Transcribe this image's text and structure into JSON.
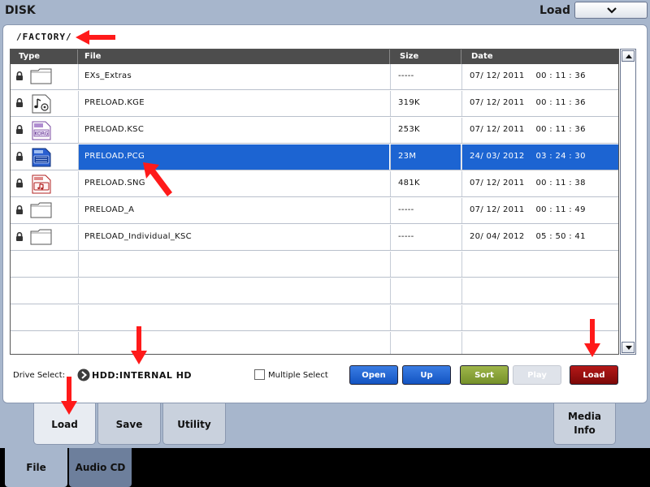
{
  "header": {
    "title": "DISK",
    "menu_label": "Load"
  },
  "path": "/FACTORY/",
  "columns": [
    "Type",
    "File",
    "Size",
    "Date"
  ],
  "rows": [
    {
      "icon": "folder-icon",
      "file": "EXs_Extras",
      "size": "-----",
      "date": "07/ 12/ 2011    00 : 11 : 36"
    },
    {
      "icon": "kge-file-icon",
      "file": "PRELOAD.KGE",
      "size": "319K",
      "date": "07/ 12/ 2011    00 : 11 : 36"
    },
    {
      "icon": "ksc-file-icon",
      "file": "PRELOAD.KSC",
      "size": "253K",
      "date": "07/ 12/ 2011    00 : 11 : 36"
    },
    {
      "icon": "pcg-file-icon",
      "file": "PRELOAD.PCG",
      "size": "23M",
      "date": "24/ 03/ 2012    03 : 24 : 30",
      "selected": true
    },
    {
      "icon": "sng-file-icon",
      "file": "PRELOAD.SNG",
      "size": "481K",
      "date": "07/ 12/ 2011    00 : 11 : 38"
    },
    {
      "icon": "folder-icon",
      "file": "PRELOAD_A",
      "size": "-----",
      "date": "07/ 12/ 2011    00 : 11 : 49"
    },
    {
      "icon": "folder-icon",
      "file": "PRELOAD_Individual_KSC",
      "size": "-----",
      "date": "20/ 04/ 2012    05 : 50 : 41"
    }
  ],
  "drive": {
    "label": "Drive Select:",
    "value": "HDD:INTERNAL HD"
  },
  "multiple_select": {
    "label": "Multiple Select",
    "checked": false
  },
  "buttons": {
    "open": "Open",
    "up": "Up",
    "sort": "Sort",
    "play": "Play",
    "load": "Load"
  },
  "tabs": {
    "load": "Load",
    "save": "Save",
    "utility": "Utility",
    "media_line1": "Media",
    "media_line2": "Info"
  },
  "mode_tabs": {
    "file": "File",
    "audio_cd": "Audio CD"
  },
  "colors": {
    "selected": "#1c64d2",
    "annotation_arrow": "#ff1a1a",
    "load_button": "#9a0f0f",
    "sort_button": "#8aa33a"
  }
}
